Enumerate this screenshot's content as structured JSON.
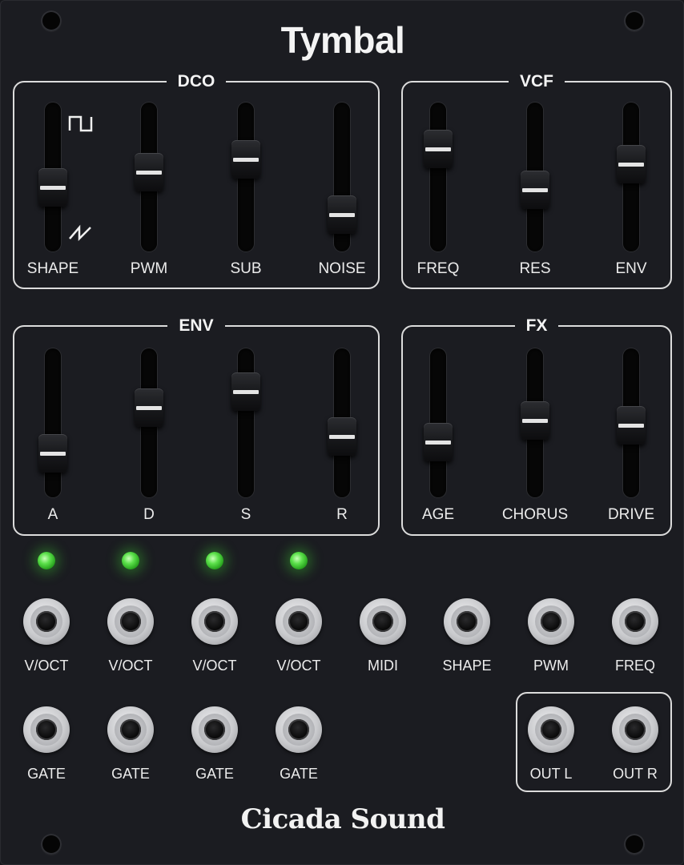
{
  "module": {
    "title": "Tymbal",
    "brand": "Cicada Sound"
  },
  "sections": {
    "dco": {
      "title": "DCO",
      "sliders": [
        {
          "label": "SHAPE",
          "value": 0.42
        },
        {
          "label": "PWM",
          "value": 0.54
        },
        {
          "label": "SUB",
          "value": 0.64
        },
        {
          "label": "NOISE",
          "value": 0.2
        }
      ],
      "shape_icons": {
        "top": "square-wave-icon",
        "bottom": "saw-wave-icon"
      }
    },
    "vcf": {
      "title": "VCF",
      "sliders": [
        {
          "label": "FREQ",
          "value": 0.72
        },
        {
          "label": "RES",
          "value": 0.4
        },
        {
          "label": "ENV",
          "value": 0.6
        }
      ]
    },
    "env": {
      "title": "ENV",
      "sliders": [
        {
          "label": "A",
          "value": 0.26
        },
        {
          "label": "D",
          "value": 0.62
        },
        {
          "label": "S",
          "value": 0.75
        },
        {
          "label": "R",
          "value": 0.39
        }
      ]
    },
    "fx": {
      "title": "FX",
      "sliders": [
        {
          "label": "AGE",
          "value": 0.35
        },
        {
          "label": "CHORUS",
          "value": 0.52
        },
        {
          "label": "DRIVE",
          "value": 0.48
        }
      ]
    }
  },
  "leds": [
    {
      "state": "on",
      "color": "#4ad83a"
    },
    {
      "state": "on",
      "color": "#4ad83a"
    },
    {
      "state": "on",
      "color": "#4ad83a"
    },
    {
      "state": "on",
      "color": "#4ad83a"
    }
  ],
  "jacks_row1": [
    "V/OCT",
    "V/OCT",
    "V/OCT",
    "V/OCT",
    "MIDI",
    "SHAPE",
    "PWM",
    "FREQ"
  ],
  "jacks_row2": [
    "GATE",
    "GATE",
    "GATE",
    "GATE"
  ],
  "outputs": [
    "OUT L",
    "OUT R"
  ],
  "colors": {
    "panel": "#1b1c21",
    "outline": "#dcdcdc",
    "led": "#4ad83a"
  }
}
